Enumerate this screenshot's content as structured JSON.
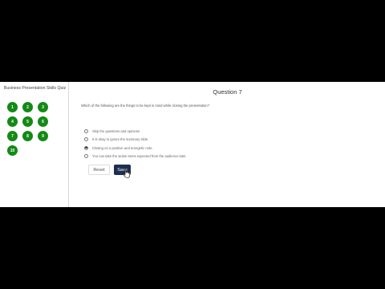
{
  "sidebar": {
    "quiz_title": "Business Presentation Skills Quiz",
    "question_numbers": [
      "1",
      "2",
      "3",
      "4",
      "5",
      "6",
      "7",
      "8",
      "9",
      "10"
    ]
  },
  "question": {
    "title": "Question 7",
    "text": "Which of the following are the things to be kept in mind while closing the presentation?",
    "options": [
      {
        "label": "Skip the questions and opinions",
        "selected": false
      },
      {
        "label": "It is okay to ignore the summary slide.",
        "selected": false
      },
      {
        "label": "Closing on a positive and energetic note.",
        "selected": true
      },
      {
        "label": "You can take the action items expected from the audience later.",
        "selected": false
      }
    ]
  },
  "actions": {
    "reset_label": "Reset",
    "save_label": "Save"
  },
  "colors": {
    "question_badge": "#138a16",
    "save_button": "#1d2e4f"
  }
}
